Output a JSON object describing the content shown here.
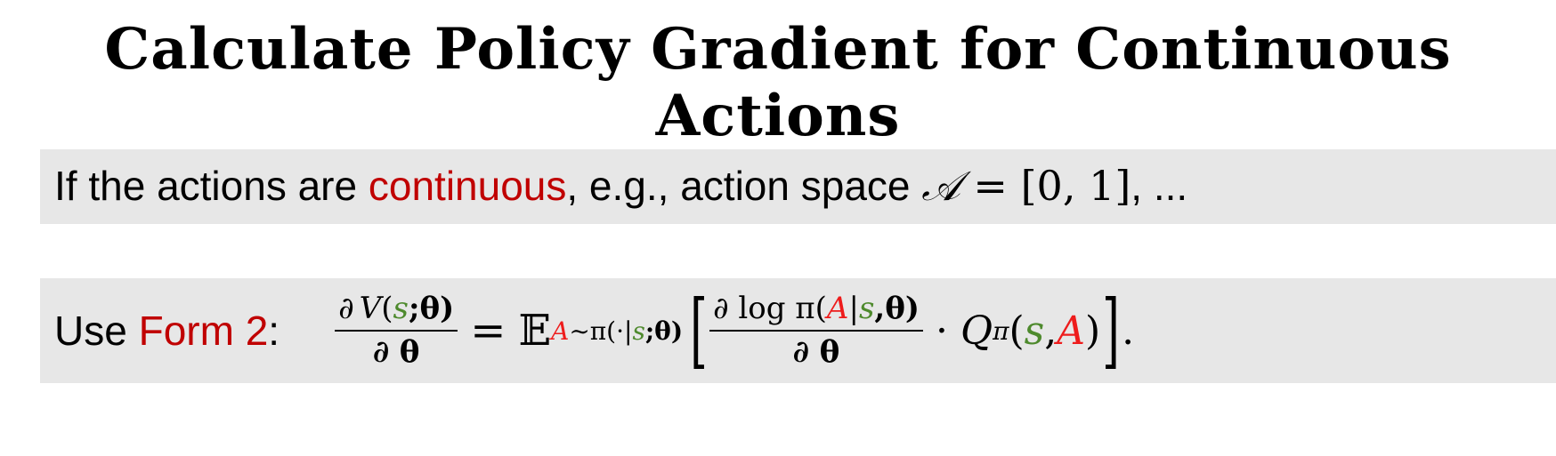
{
  "slide": {
    "title": "Calculate Policy Gradient for Continuous Actions"
  },
  "line1": {
    "prefix": "If the actions are ",
    "highlight": "continuous",
    "middle": ", e.g., action space ",
    "space_symbol": "𝒜",
    "equals": " = ",
    "interval": "[0, 1]",
    "suffix": ", ..."
  },
  "line2": {
    "prefix": "Use ",
    "highlight": "Form 2",
    "colon": ":",
    "lhs_num_partial": "∂",
    "lhs_num_v": "V",
    "lhs_num_open": "(",
    "lhs_num_s": "s",
    "lhs_num_rest": ";θ)",
    "lhs_den": "∂ θ",
    "equals": "=",
    "expect": "𝔼",
    "sub_a": "A",
    "sub_rest1": "∼π(·|",
    "sub_s": "s",
    "sub_rest2": ";θ)",
    "rhs_num_pre": "∂ log π(",
    "rhs_num_a": "A",
    "rhs_num_bar": "|",
    "rhs_num_s": "s",
    "rhs_num_post": ",θ)",
    "rhs_den": "∂ θ",
    "dot": "·",
    "q": "Q",
    "q_sub": "π",
    "q_open": "(",
    "q_s": "s",
    "q_comma": ", ",
    "q_a": "A",
    "q_close": ")",
    "end": "."
  },
  "colors": {
    "band": "#e7e7e7",
    "text_red": "#c00000",
    "math_red": "#ee1c1c",
    "math_green": "#4e8a2d"
  }
}
